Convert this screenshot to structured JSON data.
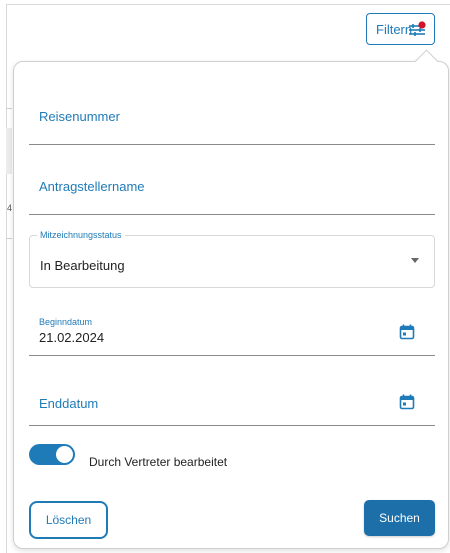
{
  "header": {
    "filter_label": "Filtern"
  },
  "form": {
    "reisenummer": {
      "placeholder": "Reisenummer"
    },
    "antragstellername": {
      "placeholder": "Antragstellername"
    },
    "mitzeichnungsstatus": {
      "label": "Mitzeichnungsstatus",
      "value": "In Bearbeitung"
    },
    "beginndatum": {
      "label": "Beginndatum",
      "value": "21.02.2024"
    },
    "enddatum": {
      "placeholder": "Enddatum"
    },
    "vertreter_toggle": {
      "label": "Durch Vertreter bearbeitet",
      "on": true
    }
  },
  "actions": {
    "clear_label": "Löschen",
    "search_label": "Suchen"
  },
  "background": {
    "partial_digit": "4"
  },
  "colors": {
    "accent": "#1f7bb8",
    "badge": "#d0142c"
  }
}
